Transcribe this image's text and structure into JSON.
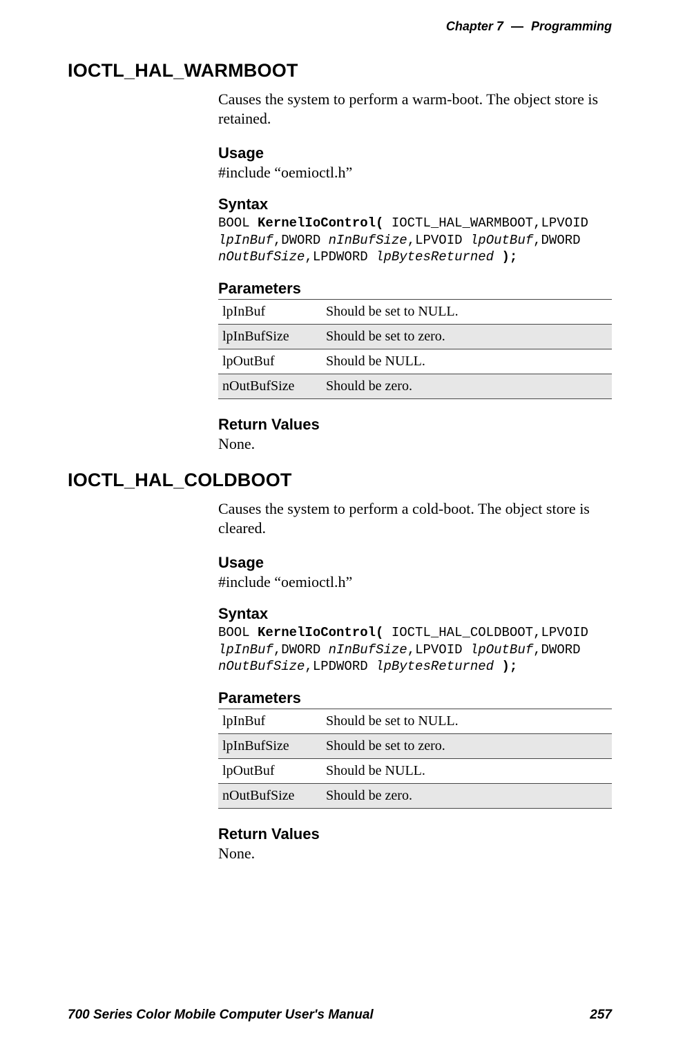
{
  "header": {
    "chapter_word": "Chapter",
    "chapter_number": "7",
    "dash": "—",
    "chapter_title": "Programming"
  },
  "sections": [
    {
      "title": "IOCTL_HAL_WARMBOOT",
      "description": "Causes the system to perform a warm-boot. The object store is retained.",
      "usage_heading": "Usage",
      "usage_text": "#include “oemioctl.h”",
      "syntax_heading": "Syntax",
      "syntax": {
        "p1a": "BOOL ",
        "p1b": "KernelIoControl(",
        "p1c": " IOCTL_HAL_WARMBOOT,LPVOID",
        "p2a": "lpInBuf",
        "p2b": ",DWORD ",
        "p2c": "nInBufSize",
        "p2d": ",LPVOID ",
        "p2e": "lpOutBuf",
        "p2f": ",DWORD",
        "p3a": "nOutBufSize",
        "p3b": ",LPDWORD ",
        "p3c": "lpBytesReturned",
        "p3d": " );"
      },
      "params_heading": "Parameters",
      "params": [
        {
          "name": "lpInBuf",
          "desc": "Should be set to NULL."
        },
        {
          "name": "lpInBufSize",
          "desc": "Should be set to zero."
        },
        {
          "name": "lpOutBuf",
          "desc": "Should be NULL."
        },
        {
          "name": "nOutBufSize",
          "desc": "Should be zero."
        }
      ],
      "return_heading": "Return Values",
      "return_text": "None."
    },
    {
      "title": "IOCTL_HAL_COLDBOOT",
      "description": "Causes the system to perform a cold-boot. The object store is cleared.",
      "usage_heading": "Usage",
      "usage_text": "#include “oemioctl.h”",
      "syntax_heading": "Syntax",
      "syntax": {
        "p1a": "BOOL ",
        "p1b": "KernelIoControl(",
        "p1c": " IOCTL_HAL_COLDBOOT,LPVOID",
        "p2a": "lpInBuf",
        "p2b": ",DWORD ",
        "p2c": "nInBufSize",
        "p2d": ",LPVOID ",
        "p2e": "lpOutBuf",
        "p2f": ",DWORD",
        "p3a": "nOutBufSize",
        "p3b": ",LPDWORD ",
        "p3c": "lpBytesReturned",
        "p3d": " );"
      },
      "params_heading": "Parameters",
      "params": [
        {
          "name": "lpInBuf",
          "desc": "Should be set to NULL."
        },
        {
          "name": "lpInBufSize",
          "desc": "Should be set to zero."
        },
        {
          "name": "lpOutBuf",
          "desc": "Should be NULL."
        },
        {
          "name": "nOutBufSize",
          "desc": "Should be zero."
        }
      ],
      "return_heading": "Return Values",
      "return_text": "None."
    }
  ],
  "footer": {
    "manual_title": "700 Series Color Mobile Computer User's Manual",
    "page_number": "257"
  }
}
